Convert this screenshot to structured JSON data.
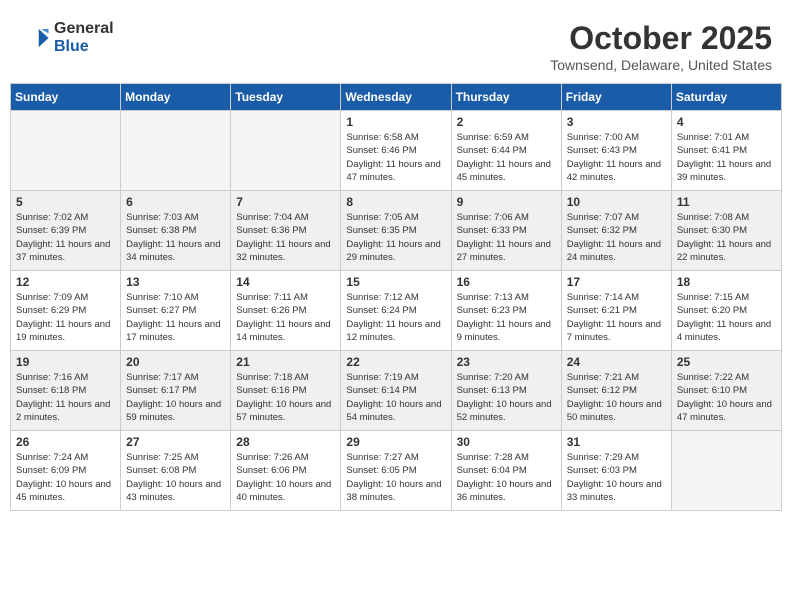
{
  "header": {
    "logo_general": "General",
    "logo_blue": "Blue",
    "month": "October 2025",
    "location": "Townsend, Delaware, United States"
  },
  "weekdays": [
    "Sunday",
    "Monday",
    "Tuesday",
    "Wednesday",
    "Thursday",
    "Friday",
    "Saturday"
  ],
  "weeks": [
    [
      {
        "day": "",
        "empty": true
      },
      {
        "day": "",
        "empty": true
      },
      {
        "day": "",
        "empty": true
      },
      {
        "day": "1",
        "sunrise": "6:58 AM",
        "sunset": "6:46 PM",
        "daylight": "11 hours and 47 minutes."
      },
      {
        "day": "2",
        "sunrise": "6:59 AM",
        "sunset": "6:44 PM",
        "daylight": "11 hours and 45 minutes."
      },
      {
        "day": "3",
        "sunrise": "7:00 AM",
        "sunset": "6:43 PM",
        "daylight": "11 hours and 42 minutes."
      },
      {
        "day": "4",
        "sunrise": "7:01 AM",
        "sunset": "6:41 PM",
        "daylight": "11 hours and 39 minutes."
      }
    ],
    [
      {
        "day": "5",
        "sunrise": "7:02 AM",
        "sunset": "6:39 PM",
        "daylight": "11 hours and 37 minutes."
      },
      {
        "day": "6",
        "sunrise": "7:03 AM",
        "sunset": "6:38 PM",
        "daylight": "11 hours and 34 minutes."
      },
      {
        "day": "7",
        "sunrise": "7:04 AM",
        "sunset": "6:36 PM",
        "daylight": "11 hours and 32 minutes."
      },
      {
        "day": "8",
        "sunrise": "7:05 AM",
        "sunset": "6:35 PM",
        "daylight": "11 hours and 29 minutes."
      },
      {
        "day": "9",
        "sunrise": "7:06 AM",
        "sunset": "6:33 PM",
        "daylight": "11 hours and 27 minutes."
      },
      {
        "day": "10",
        "sunrise": "7:07 AM",
        "sunset": "6:32 PM",
        "daylight": "11 hours and 24 minutes."
      },
      {
        "day": "11",
        "sunrise": "7:08 AM",
        "sunset": "6:30 PM",
        "daylight": "11 hours and 22 minutes."
      }
    ],
    [
      {
        "day": "12",
        "sunrise": "7:09 AM",
        "sunset": "6:29 PM",
        "daylight": "11 hours and 19 minutes."
      },
      {
        "day": "13",
        "sunrise": "7:10 AM",
        "sunset": "6:27 PM",
        "daylight": "11 hours and 17 minutes."
      },
      {
        "day": "14",
        "sunrise": "7:11 AM",
        "sunset": "6:26 PM",
        "daylight": "11 hours and 14 minutes."
      },
      {
        "day": "15",
        "sunrise": "7:12 AM",
        "sunset": "6:24 PM",
        "daylight": "11 hours and 12 minutes."
      },
      {
        "day": "16",
        "sunrise": "7:13 AM",
        "sunset": "6:23 PM",
        "daylight": "11 hours and 9 minutes."
      },
      {
        "day": "17",
        "sunrise": "7:14 AM",
        "sunset": "6:21 PM",
        "daylight": "11 hours and 7 minutes."
      },
      {
        "day": "18",
        "sunrise": "7:15 AM",
        "sunset": "6:20 PM",
        "daylight": "11 hours and 4 minutes."
      }
    ],
    [
      {
        "day": "19",
        "sunrise": "7:16 AM",
        "sunset": "6:18 PM",
        "daylight": "11 hours and 2 minutes."
      },
      {
        "day": "20",
        "sunrise": "7:17 AM",
        "sunset": "6:17 PM",
        "daylight": "10 hours and 59 minutes."
      },
      {
        "day": "21",
        "sunrise": "7:18 AM",
        "sunset": "6:16 PM",
        "daylight": "10 hours and 57 minutes."
      },
      {
        "day": "22",
        "sunrise": "7:19 AM",
        "sunset": "6:14 PM",
        "daylight": "10 hours and 54 minutes."
      },
      {
        "day": "23",
        "sunrise": "7:20 AM",
        "sunset": "6:13 PM",
        "daylight": "10 hours and 52 minutes."
      },
      {
        "day": "24",
        "sunrise": "7:21 AM",
        "sunset": "6:12 PM",
        "daylight": "10 hours and 50 minutes."
      },
      {
        "day": "25",
        "sunrise": "7:22 AM",
        "sunset": "6:10 PM",
        "daylight": "10 hours and 47 minutes."
      }
    ],
    [
      {
        "day": "26",
        "sunrise": "7:24 AM",
        "sunset": "6:09 PM",
        "daylight": "10 hours and 45 minutes."
      },
      {
        "day": "27",
        "sunrise": "7:25 AM",
        "sunset": "6:08 PM",
        "daylight": "10 hours and 43 minutes."
      },
      {
        "day": "28",
        "sunrise": "7:26 AM",
        "sunset": "6:06 PM",
        "daylight": "10 hours and 40 minutes."
      },
      {
        "day": "29",
        "sunrise": "7:27 AM",
        "sunset": "6:05 PM",
        "daylight": "10 hours and 38 minutes."
      },
      {
        "day": "30",
        "sunrise": "7:28 AM",
        "sunset": "6:04 PM",
        "daylight": "10 hours and 36 minutes."
      },
      {
        "day": "31",
        "sunrise": "7:29 AM",
        "sunset": "6:03 PM",
        "daylight": "10 hours and 33 minutes."
      },
      {
        "day": "",
        "empty": true
      }
    ]
  ]
}
